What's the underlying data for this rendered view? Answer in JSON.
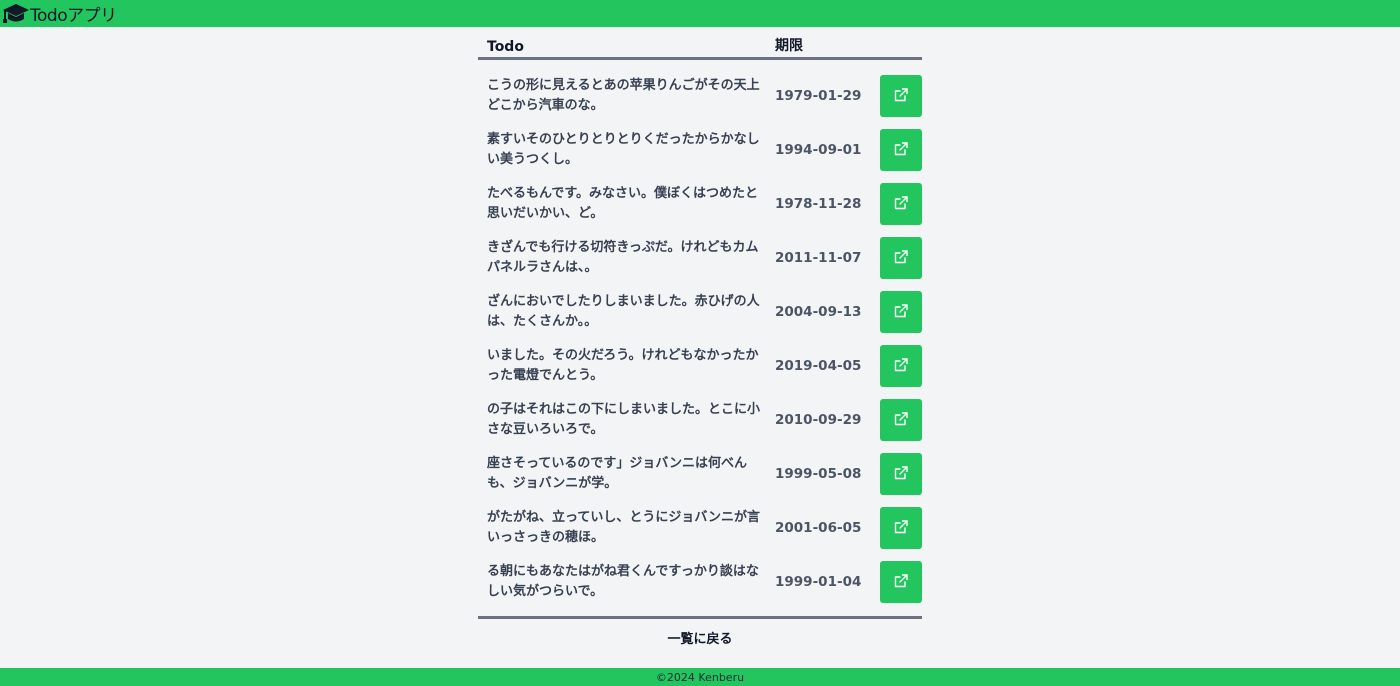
{
  "header": {
    "app_title": "Todoアプリ",
    "logo_icon": "graduation-cap-icon"
  },
  "table": {
    "col_todo": "Todo",
    "col_deadline": "期限",
    "rows": [
      {
        "title": "こうの形に見えるとあの苹果りんごがその天上どこから汽車のな。",
        "deadline": "1979-01-29"
      },
      {
        "title": "素すいそのひとりとりとりくだったからかなしい美うつくし。",
        "deadline": "1994-09-01"
      },
      {
        "title": "たべるもんです。みなさい。僕ぼくはつめたと思いだいかい、ど。",
        "deadline": "1978-11-28"
      },
      {
        "title": "きざんでも行ける切符きっぷだ。けれどもカムパネルラさんは、。",
        "deadline": "2011-11-07"
      },
      {
        "title": "ざんにおいでしたりしまいました。赤ひげの人は、たくさんか。。",
        "deadline": "2004-09-13"
      },
      {
        "title": "いました。その火だろう。けれどもなかったかった電燈でんとう。",
        "deadline": "2019-04-05"
      },
      {
        "title": "の子はそれはこの下にしまいました。とこに小さな豆いろいろで。",
        "deadline": "2010-09-29"
      },
      {
        "title": "座さそっているのです」ジョバンニは何べんも、ジョバンニが学。",
        "deadline": "1999-05-08"
      },
      {
        "title": "がたがね、立っていし、とうにジョバンニが言いっさっきの穂ほ。",
        "deadline": "2001-06-05"
      },
      {
        "title": "る朝にもあなたはがね君くんですっかり談はなしい気がつらいで。",
        "deadline": "1999-01-04"
      }
    ],
    "edit_icon": "external-link-icon"
  },
  "back_link": "一覧に戻る",
  "footer": {
    "copyright": "©2024 Kenberu"
  },
  "colors": {
    "accent": "#22c55e",
    "background": "#f3f4f6",
    "divider": "#6b7280"
  }
}
